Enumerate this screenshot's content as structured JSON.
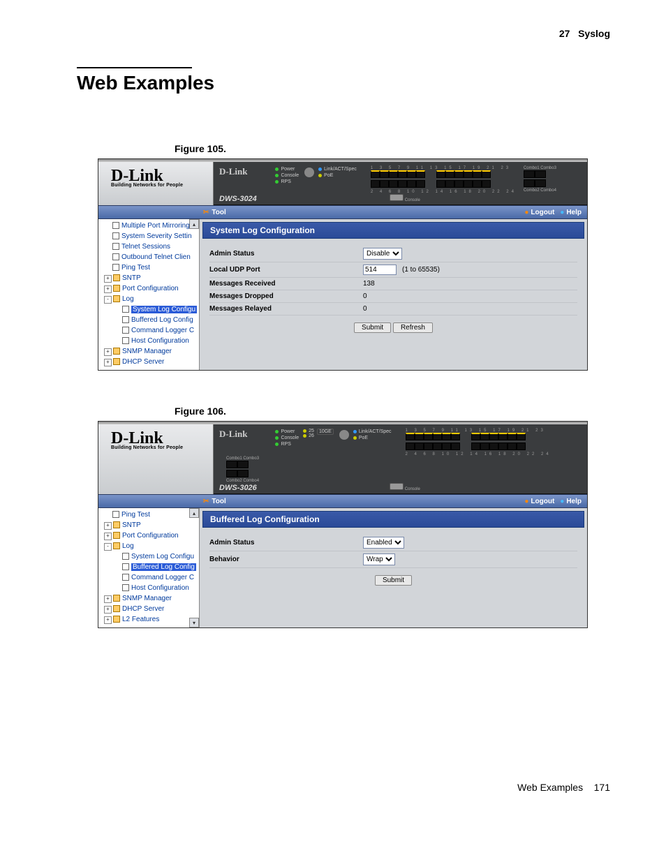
{
  "header": {
    "chapter_num": "27",
    "chapter_title": "Syslog"
  },
  "section": {
    "title": "Web Examples"
  },
  "footer": {
    "label": "Web Examples",
    "page": "171"
  },
  "figures": [
    {
      "caption": "Figure 105.",
      "brand": "D-Link",
      "tagline": "Building Networks for People",
      "model": "DWS-3024",
      "toolbar": {
        "tool": "Tool",
        "logout": "Logout",
        "help": "Help"
      },
      "status_leds": [
        "Power",
        "Console",
        "RPS"
      ],
      "linkact": "Link/ACT/Spec",
      "poe": "PoE",
      "console": "Console",
      "port_top_nums": "1   3   5   7   9   11        13  15  17  19  21  23",
      "port_bot_nums": "2   4   6   8   10  12        14  16  18  20  22  24",
      "combo1": "Combo1 Combo3",
      "combo2": "Combo2 Combo4",
      "tree": [
        {
          "lvl": 2,
          "icon": "doc",
          "label": "Multiple Port Mirroring"
        },
        {
          "lvl": 2,
          "icon": "doc",
          "label": "System Severity Settin"
        },
        {
          "lvl": 2,
          "icon": "doc",
          "label": "Telnet Sessions"
        },
        {
          "lvl": 2,
          "icon": "doc",
          "label": "Outbound Telnet Clien"
        },
        {
          "lvl": 2,
          "icon": "doc",
          "label": "Ping Test"
        },
        {
          "lvl": 1,
          "icon": "folder",
          "exp": "+",
          "label": "SNTP"
        },
        {
          "lvl": 1,
          "icon": "folder",
          "exp": "+",
          "label": "Port Configuration"
        },
        {
          "lvl": 1,
          "icon": "folder",
          "exp": "-",
          "label": "Log"
        },
        {
          "lvl": 3,
          "icon": "doc",
          "label": "System Log Configu",
          "sel": true
        },
        {
          "lvl": 3,
          "icon": "doc",
          "label": "Buffered Log Config"
        },
        {
          "lvl": 3,
          "icon": "doc",
          "label": "Command Logger C"
        },
        {
          "lvl": 3,
          "icon": "doc",
          "label": "Host Configuration"
        },
        {
          "lvl": 1,
          "icon": "folder",
          "exp": "+",
          "label": "SNMP Manager"
        },
        {
          "lvl": 1,
          "icon": "folder",
          "exp": "+",
          "label": "DHCP Server"
        }
      ],
      "panel_title": "System Log Configuration",
      "rows": [
        {
          "label": "Admin Status",
          "type": "select",
          "value": "Disable"
        },
        {
          "label": "Local UDP Port",
          "type": "input",
          "value": "514",
          "hint": "(1 to 65535)"
        },
        {
          "label": "Messages Received",
          "type": "text",
          "value": "138"
        },
        {
          "label": "Messages Dropped",
          "type": "text",
          "value": "0"
        },
        {
          "label": "Messages Relayed",
          "type": "text",
          "value": "0"
        }
      ],
      "buttons": [
        "Submit",
        "Refresh"
      ]
    },
    {
      "caption": "Figure 106.",
      "brand": "D-Link",
      "tagline": "Building Networks for People",
      "model": "DWS-3026",
      "toolbar": {
        "tool": "Tool",
        "logout": "Logout",
        "help": "Help"
      },
      "status_leds": [
        "Power",
        "Console",
        "RPS"
      ],
      "extra_leds": [
        "25",
        "26"
      ],
      "tenge": "10GE",
      "linkact": "Link/ACT/Spec",
      "poe": "PoE",
      "console": "Console",
      "port_top_nums": "1   3   5   7   9   11        13  15  17  19  21  23",
      "port_bot_nums": "2   4   6   8   10  12        14  16  18  20  22  24",
      "combo1": "Combo1 Combo3",
      "combo2": "Combo2 Combo4",
      "tree": [
        {
          "lvl": 2,
          "icon": "doc",
          "label": "Ping Test"
        },
        {
          "lvl": 1,
          "icon": "folder",
          "exp": "+",
          "label": "SNTP"
        },
        {
          "lvl": 1,
          "icon": "folder",
          "exp": "+",
          "label": "Port Configuration"
        },
        {
          "lvl": 1,
          "icon": "folder",
          "exp": "-",
          "label": "Log"
        },
        {
          "lvl": 3,
          "icon": "doc",
          "label": "System Log Configu"
        },
        {
          "lvl": 3,
          "icon": "doc",
          "label": "Buffered Log Config",
          "sel": true
        },
        {
          "lvl": 3,
          "icon": "doc",
          "label": "Command Logger C"
        },
        {
          "lvl": 3,
          "icon": "doc",
          "label": "Host Configuration"
        },
        {
          "lvl": 1,
          "icon": "folder",
          "exp": "+",
          "label": "SNMP Manager"
        },
        {
          "lvl": 1,
          "icon": "folder",
          "exp": "+",
          "label": "DHCP Server"
        },
        {
          "lvl": 1,
          "icon": "folder",
          "exp": "+",
          "label": "L2 Features"
        }
      ],
      "panel_title": "Buffered Log Configuration",
      "rows": [
        {
          "label": "Admin Status",
          "type": "select",
          "value": "Enabled"
        },
        {
          "label": "Behavior",
          "type": "select",
          "value": "Wrap"
        }
      ],
      "buttons": [
        "Submit"
      ]
    }
  ]
}
